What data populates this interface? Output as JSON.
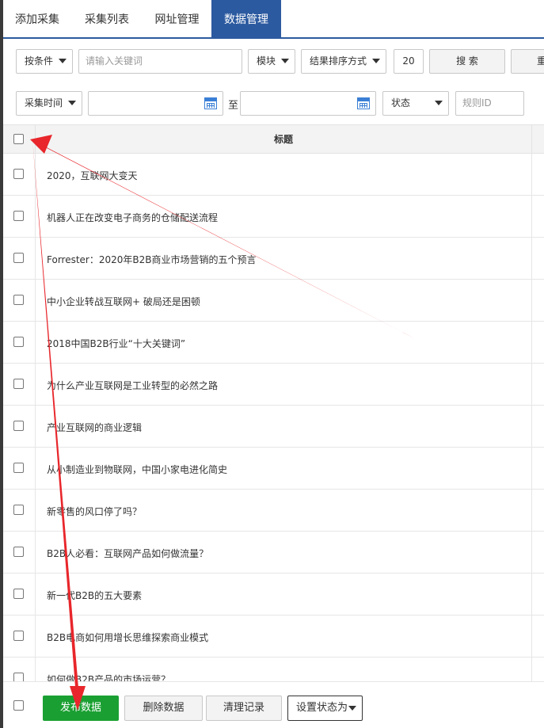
{
  "tabs": [
    {
      "label": "添加采集"
    },
    {
      "label": "采集列表"
    },
    {
      "label": "网址管理"
    },
    {
      "label": "数据管理",
      "active": true
    }
  ],
  "filters": {
    "condition_select": "按条件",
    "keyword_placeholder": "请输入关键词",
    "module_select": "模块",
    "sort_select": "结果排序方式",
    "page_size": "20",
    "search_button": "搜 索",
    "reset_button_partial": "重",
    "time_select": "采集时间",
    "date_start": "",
    "date_to_label": "至",
    "date_end": "",
    "status_select": "状态",
    "rule_id_placeholder": "规则ID"
  },
  "table": {
    "header_title": "标题",
    "rows": [
      "2020，互联网大变天",
      "机器人正在改变电子商务的仓储配送流程",
      "Forrester：2020年B2B商业市场营销的五个预言",
      "中小企业转战互联网+ 破局还是困顿",
      "2018中国B2B行业“十大关键词”",
      "为什么产业互联网是工业转型的必然之路",
      "产业互联网的商业逻辑",
      "从小制造业到物联网，中国小家电进化简史",
      "新零售的风口停了吗？",
      "B2B人必看：互联网产品如何做流量？",
      "新一代B2B的五大要素",
      "B2B电商如何用增长思维探索商业模式",
      "如何做B2B产品的市场运营？"
    ]
  },
  "footer": {
    "publish_button": "发布数据",
    "delete_button": "删除数据",
    "clear_button": "清理记录",
    "set_status_select": "设置状态为"
  },
  "colors": {
    "accent": "#2c5aa0",
    "publish_green": "#1aa032",
    "annotation_red": "#e8262b"
  }
}
